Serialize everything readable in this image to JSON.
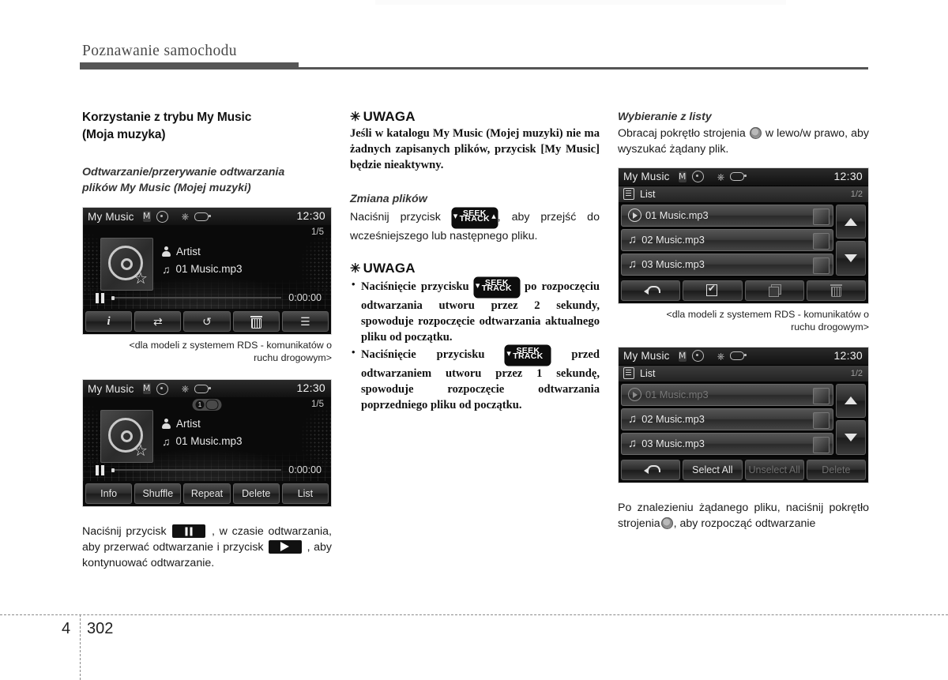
{
  "page": {
    "chapter_title": "Poznawanie samochodu",
    "footer_chapter": "4",
    "footer_page": "302"
  },
  "col1": {
    "section_title_line1": "Korzystanie z trybu My Music",
    "section_title_line2": "(Moja muzyka)",
    "sub_title_line1": "Odtwarzanie/przerywanie odtwarzania",
    "sub_title_line2": "plików My Music (Mojej muzyki)",
    "caption_line1": "<dla modeli z systemem RDS - komunikatów o",
    "caption_line2": "ruchu drogowym>",
    "paragraph_a": "Naciśnij przycisk",
    "paragraph_b": ", w czasie odtwarzania, aby przerwać odtwarzanie i przycisk",
    "paragraph_c": ", aby kontynuować odtwarzanie."
  },
  "col2": {
    "note1_star": "✳",
    "note1_head": "UWAGA",
    "note1_body": "Jeśli w katalogu My Music (Mojej muzyki) nie ma żadnych zapisanych plików, przycisk [My Music] będzie nieaktywny.",
    "sub_title": "Zmiana plików",
    "change_a": "Naciśnij przycisk",
    "change_b": ", aby przejść do wcześniejszego lub następnego pliku.",
    "note2_star": "✳",
    "note2_head": "UWAGA",
    "bullet1_a": "Naciśnięcie przycisku",
    "bullet1_b": "po rozpoczęciu odtwarzania utworu przez 2 sekundy, spowoduje rozpoczęcie odtwarzania aktualnego pliku od początku.",
    "bullet2_a": "Naciśnięcie przycisku",
    "bullet2_b": "przed odtwarzaniem utworu przez 1 sekundę, spowoduje rozpoczęcie odtwarzania poprzedniego pliku od początku.",
    "seek_label_top": "SEEK",
    "seek_label_bottom": "TRACK"
  },
  "col3": {
    "sub_title": "Wybieranie z listy",
    "intro_a": "Obracaj pokrętło strojenia",
    "intro_b": "w lewo/w prawo, aby wyszukać żądany plik.",
    "caption_line1": "<dla modeli z systemem RDS - komunikatów o",
    "caption_line2": "ruchu drogowym>",
    "outro_a": "Po znalezieniu żądanego pliku, naciśnij pokrętło strojenia",
    "outro_b": ", aby rozpocząć odtwarzanie"
  },
  "device1": {
    "title": "My Music",
    "clock": "12:30",
    "track_index": "1/5",
    "artist": "Artist",
    "track": "01 Music.mp3",
    "time": "0:00:00",
    "buttons": [
      {
        "name": "info",
        "glyph": "i"
      },
      {
        "name": "shuffle",
        "glyph": "⇄"
      },
      {
        "name": "repeat",
        "glyph": "↺"
      },
      {
        "name": "delete",
        "glyph": "trash"
      },
      {
        "name": "list",
        "glyph": "☰"
      }
    ]
  },
  "device2": {
    "title": "My Music",
    "clock": "12:30",
    "track_index": "1/5",
    "repeat_badge": "1",
    "artist": "Artist",
    "track": "01 Music.mp3",
    "time": "0:00:00",
    "buttons": [
      "Info",
      "Shuffle",
      "Repeat",
      "Delete",
      "List"
    ]
  },
  "device3": {
    "title": "My Music",
    "clock": "12:30",
    "list_label": "List",
    "page": "1/2",
    "rows": [
      {
        "label": "01 Music.mp3",
        "icon": "play-circle-icon",
        "dim": false
      },
      {
        "label": "02 Music.mp3",
        "icon": "music-note-icon",
        "dim": false
      },
      {
        "label": "03 Music.mp3",
        "icon": "music-note-icon",
        "dim": false
      }
    ],
    "scroll_up": "▲",
    "scroll_down": "▼",
    "buttons": [
      {
        "name": "back",
        "glyph": "back"
      },
      {
        "name": "select",
        "glyph": "checkdoc"
      },
      {
        "name": "copy",
        "glyph": "copy"
      },
      {
        "name": "delete",
        "glyph": "trash"
      }
    ]
  },
  "device4": {
    "title": "My Music",
    "clock": "12:30",
    "list_label": "List",
    "page": "1/2",
    "rows": [
      {
        "label": "01 Music.mp3",
        "icon": "play-circle-icon",
        "dim": true
      },
      {
        "label": "02 Music.mp3",
        "icon": "music-note-icon",
        "dim": false
      },
      {
        "label": "03 Music.mp3",
        "icon": "music-note-icon",
        "dim": false
      }
    ],
    "scroll_up": "▲",
    "scroll_down": "▼",
    "buttons": [
      {
        "name": "back",
        "label": "",
        "glyph": "back",
        "dim": false
      },
      {
        "name": "select-all",
        "label": "Select All",
        "dim": false
      },
      {
        "name": "unselect-all",
        "label": "Unselect All",
        "dim": true
      },
      {
        "name": "delete",
        "label": "Delete",
        "dim": true
      }
    ]
  }
}
